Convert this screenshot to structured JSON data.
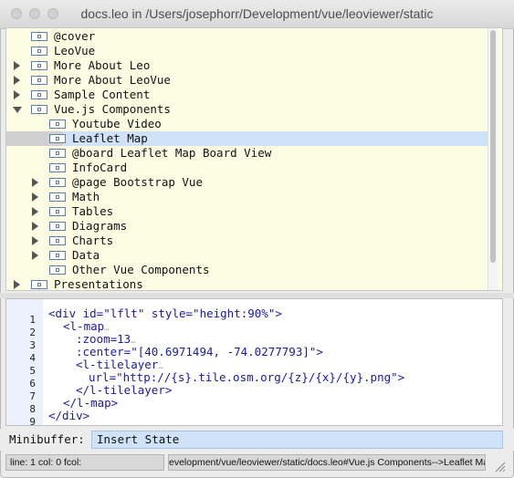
{
  "window": {
    "title": "docs.leo in /Users/josephorr/Development/vue/leoviewer/static"
  },
  "outline": {
    "nodes": [
      {
        "label": "@cover"
      },
      {
        "label": "LeoVue"
      },
      {
        "label": "More About Leo"
      },
      {
        "label": "More About LeoVue"
      },
      {
        "label": "Sample Content"
      },
      {
        "label": "Vue.js Components"
      },
      {
        "label": "Youtube Video"
      },
      {
        "label": "Leaflet Map"
      },
      {
        "label": "@board Leaflet Map Board View"
      },
      {
        "label": "InfoCard"
      },
      {
        "label": "@page Bootstrap Vue"
      },
      {
        "label": "Math"
      },
      {
        "label": "Tables"
      },
      {
        "label": "Diagrams"
      },
      {
        "label": "Charts"
      },
      {
        "label": "Data"
      },
      {
        "label": "Other Vue Components"
      },
      {
        "label": "Presentations"
      }
    ]
  },
  "body": {
    "line_numbers": [
      "1",
      "2",
      "3",
      "4",
      "5",
      "6",
      "7",
      "8",
      "9"
    ],
    "lines": {
      "l1": "<div id=\"lflt\" style=\"height:90%\">",
      "l2": "<l-map",
      "l3": ":zoom=13",
      "l4a": ":center=\"[40.6971494, -74.0277793]\">",
      "l5": "<l-tilelayer",
      "l6": "url=\"http://{s}.tile.osm.org/{z}/{x}/{y}.png\">",
      "l7": "</l-tilelayer>",
      "l8": "</l-map>",
      "l9": "</div>",
      "ellipsis": "…"
    }
  },
  "minibuffer": {
    "label": "Minibuffer:",
    "value": "Insert State"
  },
  "status": {
    "position": "line: 1 col: 0 fcol:",
    "path": "evelopment/vue/leoviewer/static/docs.leo#Vue.js Components-->Leaflet Map"
  },
  "colors": {
    "outline_bg": "#fdfde4",
    "selection": "#cfe2f8",
    "code_text": "#1a1aa6"
  }
}
